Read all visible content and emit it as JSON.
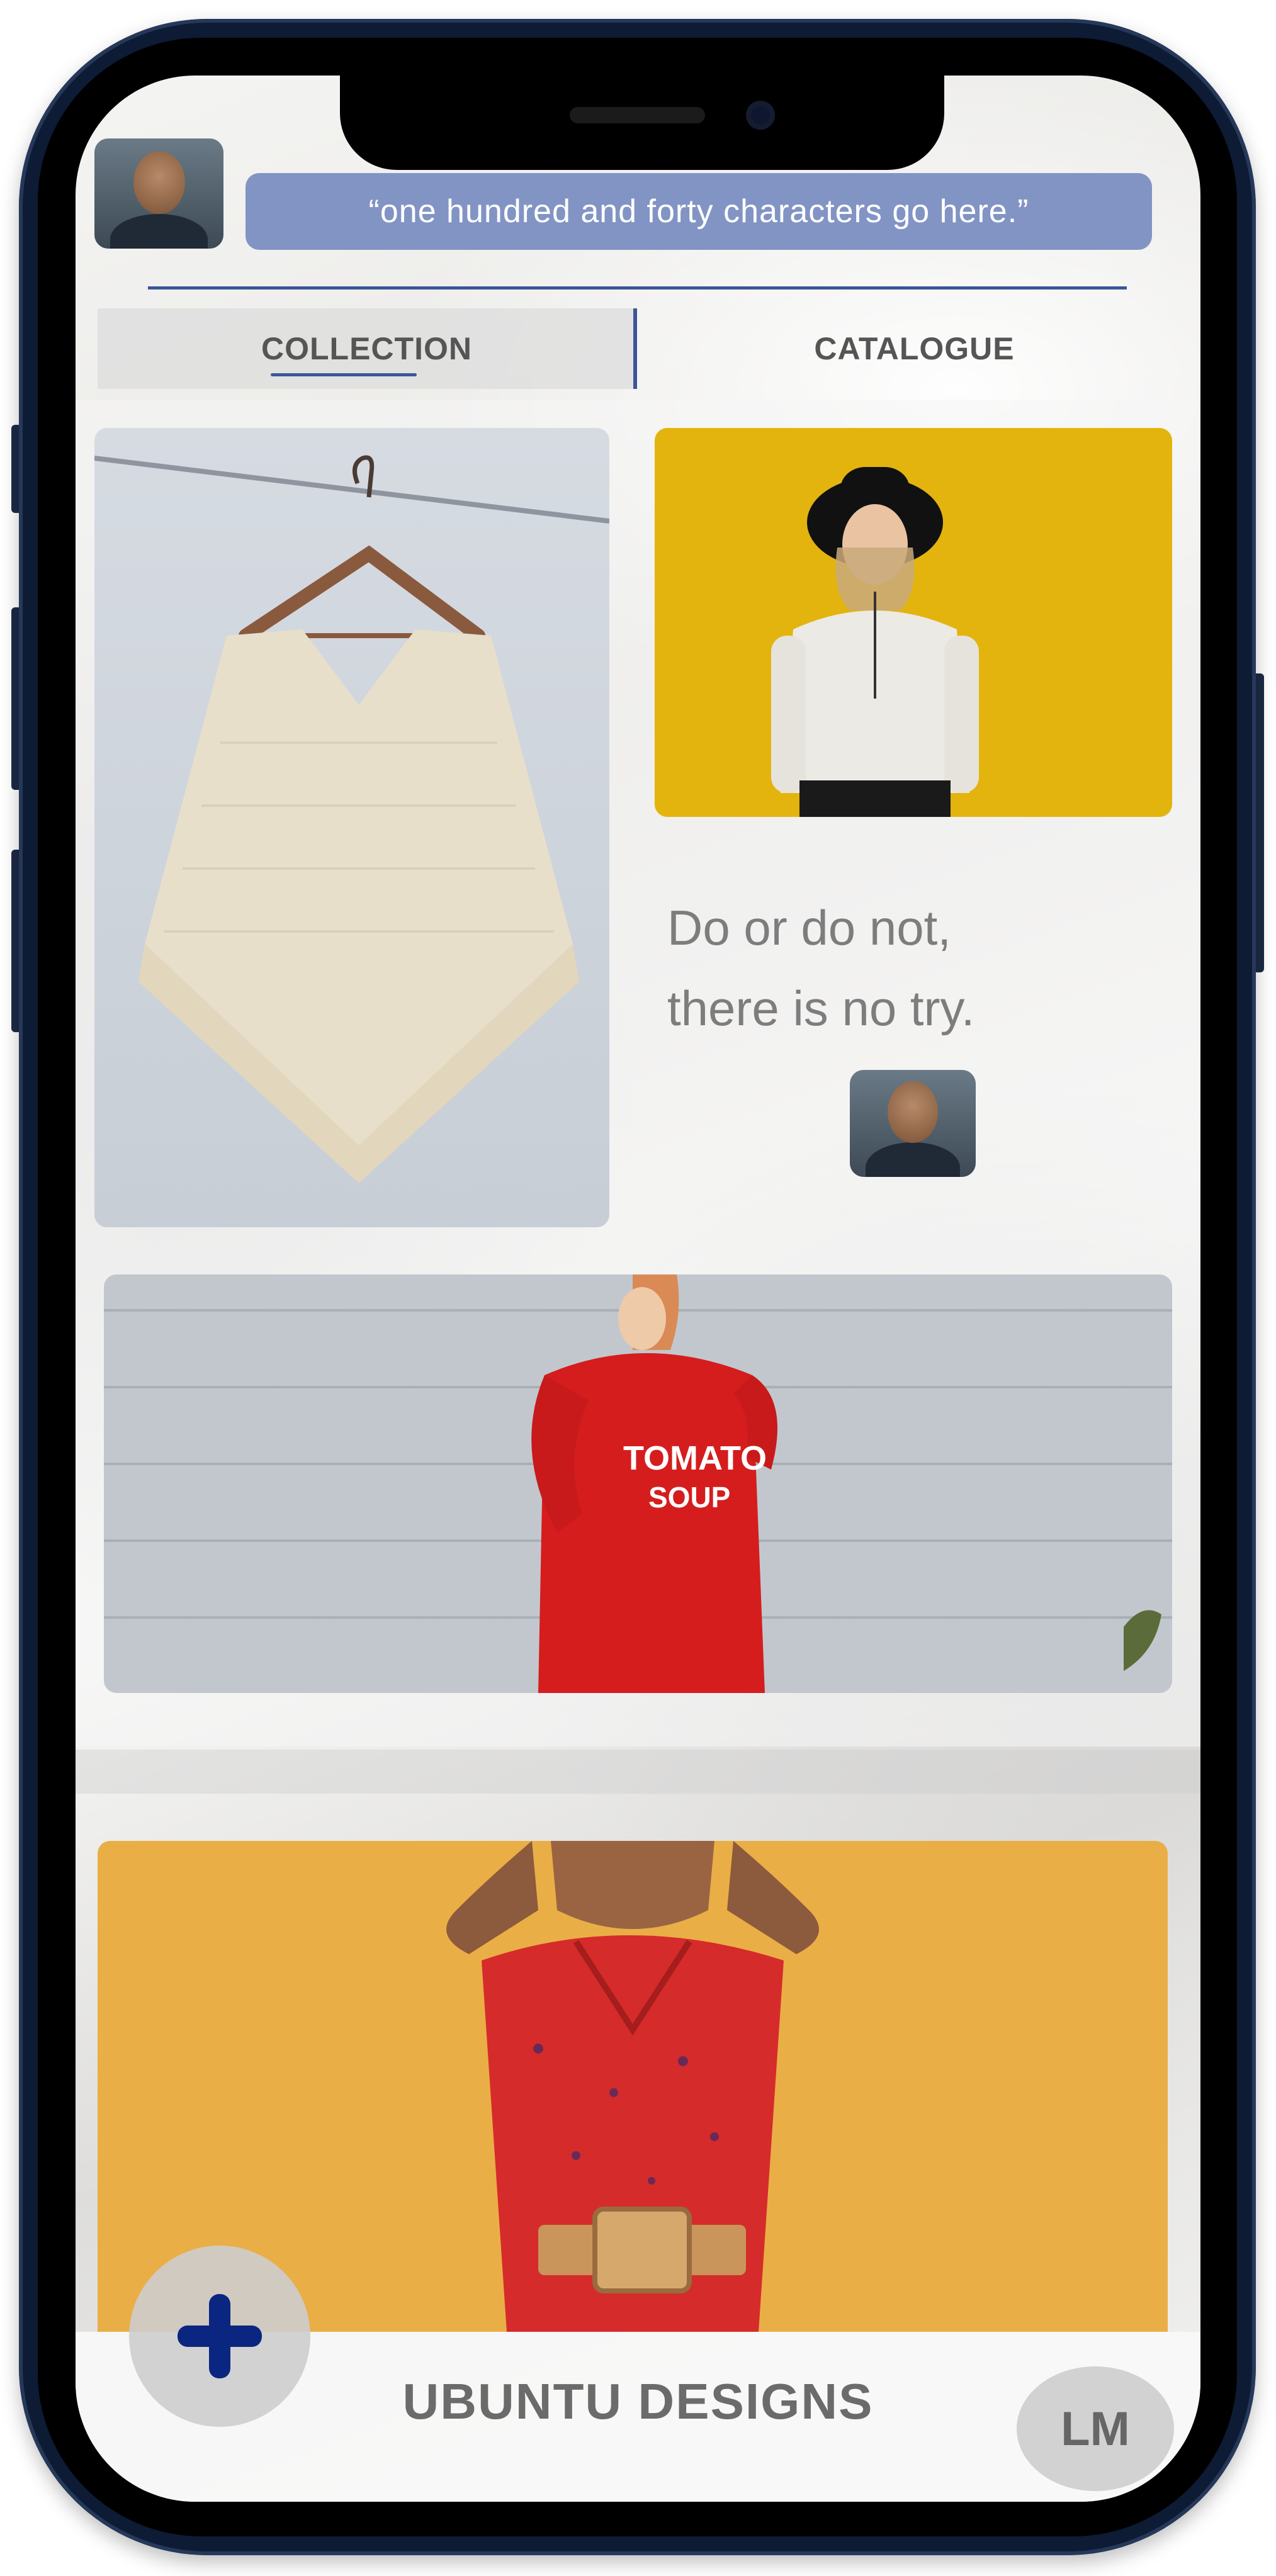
{
  "header": {
    "status_quote": "“one hundred and forty characters go here.”"
  },
  "tabs": [
    {
      "label": "COLLECTION",
      "active": true
    },
    {
      "label": "CATALOGUE",
      "active": false
    }
  ],
  "feed": {
    "quote_card": {
      "line1": "Do or do not,",
      "line2": "there is no try."
    },
    "tomato_shirt": {
      "line1": "TOMATO",
      "line2": "SOUP"
    }
  },
  "footer": {
    "brand": "UBUNTU DESIGNS",
    "add_icon": "plus-icon",
    "user_initials": "LM"
  },
  "colors": {
    "accent": "#3b5697",
    "quote_bar": "#8294c4",
    "fab_plus": "#0b2680"
  }
}
